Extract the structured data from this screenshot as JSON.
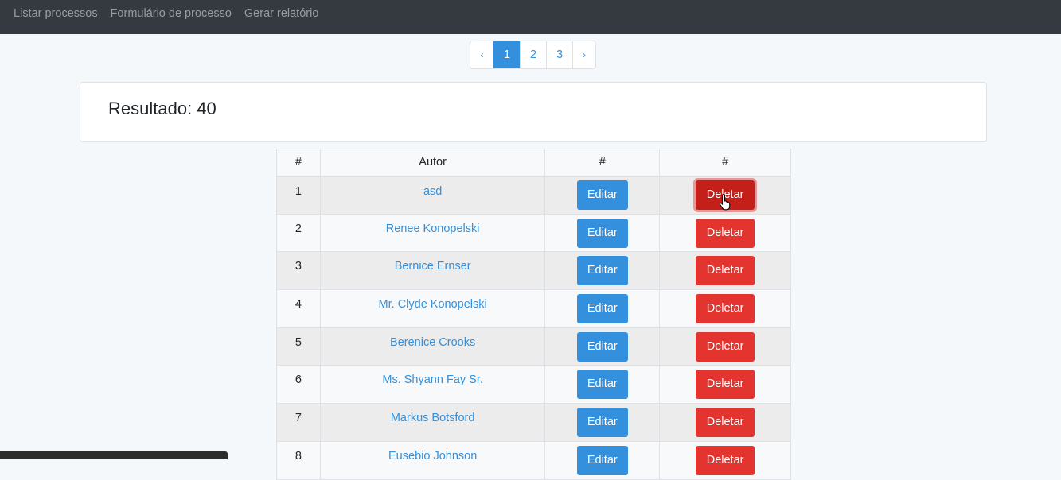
{
  "nav": {
    "links": [
      "Listar processos",
      "Formulário de processo",
      "Gerar relatório"
    ]
  },
  "pagination": {
    "prev": "‹",
    "pages": [
      "1",
      "2",
      "3"
    ],
    "active": "1",
    "next": "›"
  },
  "result": {
    "label": "Resultado: 40"
  },
  "table": {
    "headers": [
      "#",
      "Autor",
      "#",
      "#"
    ],
    "rows": [
      {
        "idx": "1",
        "autor": "asd",
        "edit": "Editar",
        "delete": "Deletar"
      },
      {
        "idx": "2",
        "autor": "Renee Konopelski",
        "edit": "Editar",
        "delete": "Deletar"
      },
      {
        "idx": "3",
        "autor": "Bernice Ernser",
        "edit": "Editar",
        "delete": "Deletar"
      },
      {
        "idx": "4",
        "autor": "Mr. Clyde Konopelski",
        "edit": "Editar",
        "delete": "Deletar"
      },
      {
        "idx": "5",
        "autor": "Berenice Crooks",
        "edit": "Editar",
        "delete": "Deletar"
      },
      {
        "idx": "6",
        "autor": "Ms. Shyann Fay Sr.",
        "edit": "Editar",
        "delete": "Deletar"
      },
      {
        "idx": "7",
        "autor": "Markus Botsford",
        "edit": "Editar",
        "delete": "Deletar"
      },
      {
        "idx": "8",
        "autor": "Eusebio Johnson",
        "edit": "Editar",
        "delete": "Deletar"
      }
    ]
  },
  "colors": {
    "primary": "#3490dc",
    "danger": "#e3342f",
    "navbar": "#343a40"
  },
  "icons": {
    "cursor": "hand-pointer-icon"
  }
}
